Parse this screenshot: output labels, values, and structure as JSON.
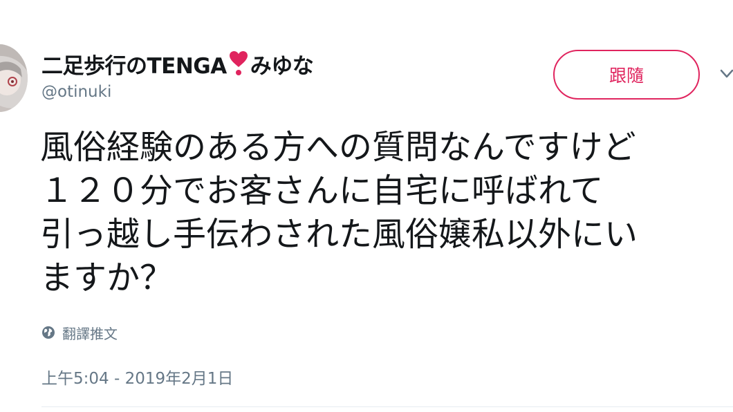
{
  "author": {
    "name_prefix": "二足歩行のTENGA",
    "name_suffix": "みゆな",
    "handle": "@otinuki",
    "heart_icon": "heavy-heart-exclamation-icon"
  },
  "actions": {
    "follow_label": "跟隨",
    "menu_icon": "chevron-down-icon"
  },
  "tweet": {
    "lines": [
      "風俗経験のある方への質問なんですけど",
      "１２０分でお客さんに自宅に呼ばれて",
      "引っ越し手伝わされた風俗嬢私以外にい",
      "ますか？"
    ],
    "translate_label": "翻譯推文",
    "translate_icon": "globe-icon",
    "timestamp": "上午5:04 - 2019年2月1日"
  },
  "colors": {
    "accent": "#e0245e",
    "text": "#14171a",
    "secondary": "#657786",
    "divider": "#e6ecf0"
  }
}
